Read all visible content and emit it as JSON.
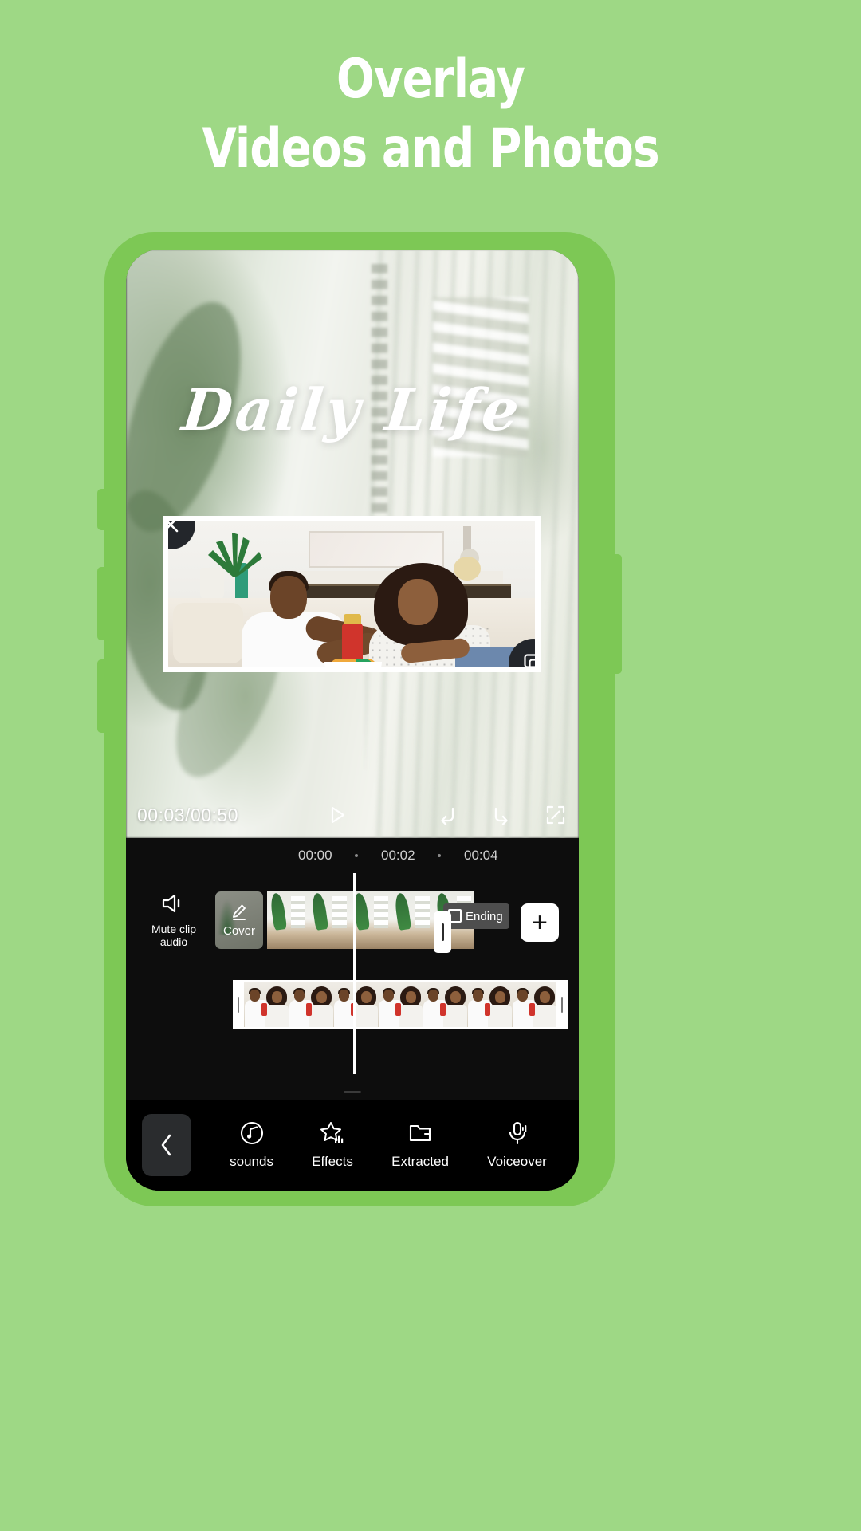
{
  "page": {
    "background_color": "#9ed885",
    "headline_line1": "Overlay",
    "headline_line2": "Videos and Photos"
  },
  "preview": {
    "title_overlay_text": "Daily Life",
    "close_icon": "close-icon",
    "resize_icon": "resize-overlay-icon"
  },
  "player": {
    "current_time": "00:03",
    "total_time": "00:50",
    "time_display": "00:03/00:50",
    "play_icon": "play-icon",
    "undo_icon": "undo-icon",
    "redo_icon": "redo-icon",
    "fullscreen_icon": "fullscreen-icon"
  },
  "timeline": {
    "ruler_ticks": [
      "00:00",
      "00:02",
      "00:04"
    ],
    "mute_clip_label_line1": "Mute clip",
    "mute_clip_label_line2": "audio",
    "mute_icon": "speaker-mute-icon",
    "cover_label": "Cover",
    "cover_icon": "pencil-edit-icon",
    "ending_label": "Ending",
    "ending_icon": "ending-card-icon",
    "add_label": "+"
  },
  "toolbar": {
    "back_icon": "chevron-left-icon",
    "items": [
      {
        "label": "sounds",
        "icon": "music-note-icon"
      },
      {
        "label": "Effects",
        "icon": "star-effects-icon"
      },
      {
        "label": "Extracted",
        "icon": "folder-icon"
      },
      {
        "label": "Voiceover",
        "icon": "microphone-icon"
      }
    ]
  }
}
